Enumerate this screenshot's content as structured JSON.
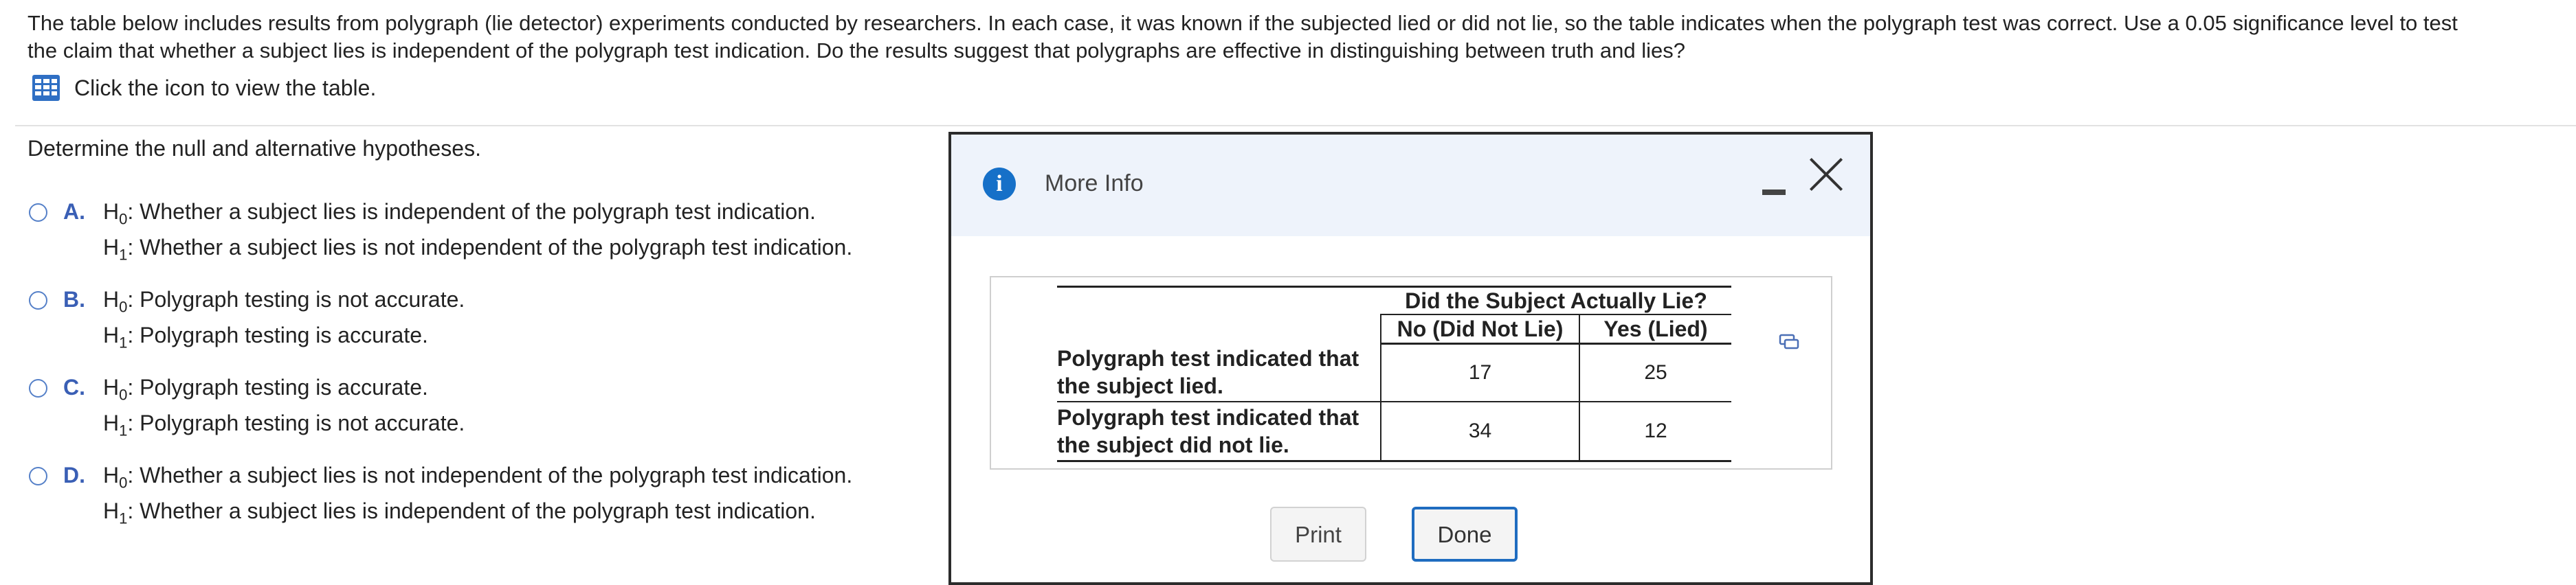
{
  "question": {
    "text_line1": "The table below includes results from polygraph (lie detector) experiments conducted by researchers. In each case, it was known if the subjected lied or did not lie, so the table indicates when the polygraph test was correct. Use a 0.05 significance level to test",
    "text_line2": "the claim that whether a subject lies is independent of the polygraph test indication. Do the results suggest that polygraphs are effective in distinguishing between truth and lies?",
    "view_table_text": "Click the icon to view the table."
  },
  "prompt": "Determine the null and alternative hypotheses.",
  "options": [
    {
      "letter": "A.",
      "h0_label": "H",
      "h0_sub": "0",
      "h0": ": Whether a subject lies is independent of the polygraph test indication.",
      "h1_label": "H",
      "h1_sub": "1",
      "h1": ": Whether a subject lies is not independent of the polygraph test indication."
    },
    {
      "letter": "B.",
      "h0_label": "H",
      "h0_sub": "0",
      "h0": ": Polygraph testing is not accurate.",
      "h1_label": "H",
      "h1_sub": "1",
      "h1": ": Polygraph testing is accurate."
    },
    {
      "letter": "C.",
      "h0_label": "H",
      "h0_sub": "0",
      "h0": ": Polygraph testing is accurate.",
      "h1_label": "H",
      "h1_sub": "1",
      "h1": ": Polygraph testing is not accurate."
    },
    {
      "letter": "D.",
      "h0_label": "H",
      "h0_sub": "0",
      "h0": ": Whether a subject lies is not independent of the polygraph test indication.",
      "h1_label": "H",
      "h1_sub": "1",
      "h1": ": Whether a subject lies is independent of the polygraph test indication."
    }
  ],
  "modal": {
    "title": "More Info",
    "table": {
      "group_header": "Did the Subject Actually Lie?",
      "col_no": "No (Did Not Lie)",
      "col_yes": "Yes (Lied)",
      "rows": [
        {
          "label_line1": "Polygraph test indicated that",
          "label_line2": "the subject lied.",
          "no": "17",
          "yes": "25"
        },
        {
          "label_line1": "Polygraph test indicated that",
          "label_line2": "the subject did not lie.",
          "no": "34",
          "yes": "12"
        }
      ]
    },
    "print_label": "Print",
    "done_label": "Done"
  },
  "colors": {
    "accent": "#1f6cc0",
    "option_letter": "#3a5fb5",
    "info_icon": "#1670c8",
    "header_bg": "#eef3fb"
  }
}
